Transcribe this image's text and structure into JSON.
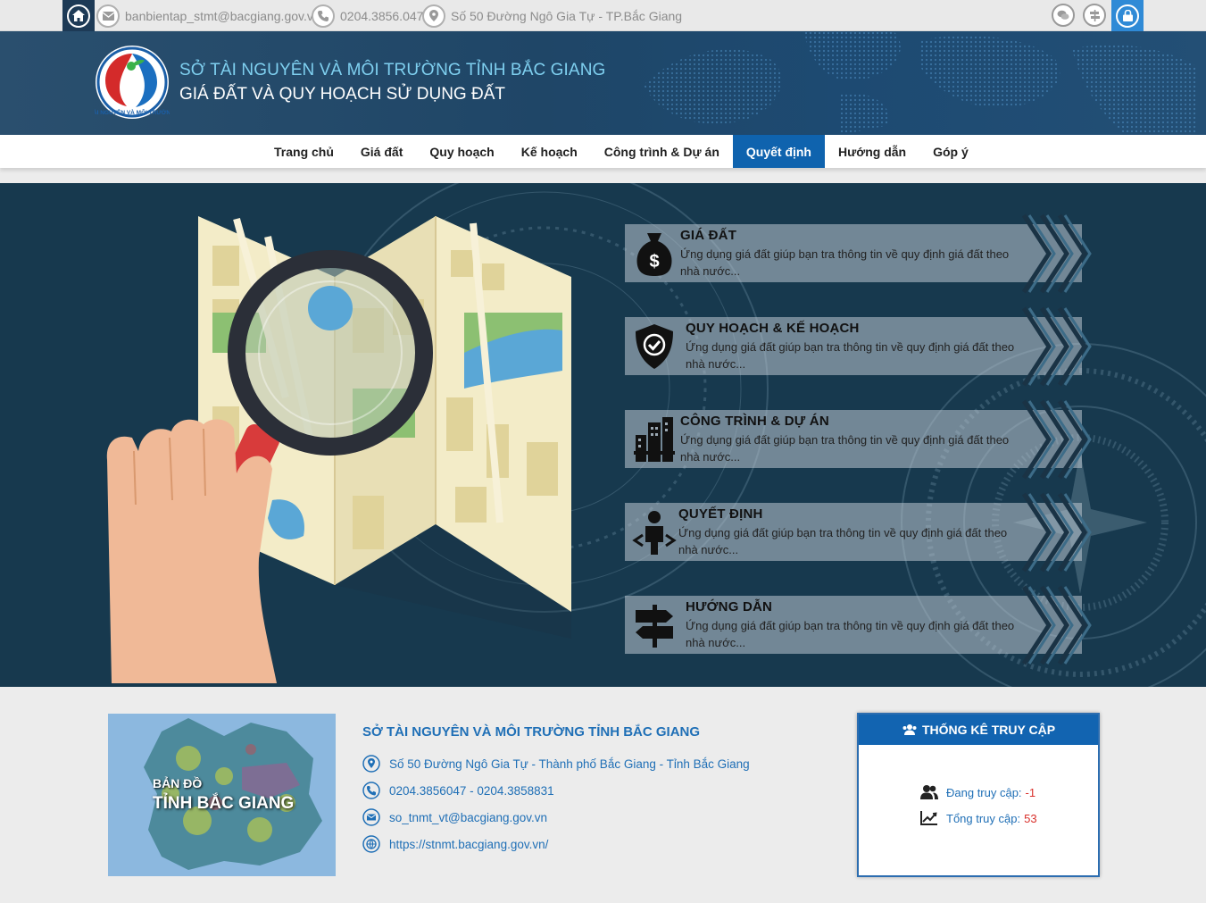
{
  "topbar": {
    "email": "banbientap_stmt@bacgiang.gov.vn",
    "phone": "0204.3856.047",
    "address": "Số 50 Đường Ngô Gia Tự - TP.Bắc Giang",
    "icons": [
      "home-icon",
      "mail-icon",
      "phone-icon",
      "map-pin-icon",
      "chat-icon",
      "signpost-icon",
      "lock-icon"
    ]
  },
  "header": {
    "title1": "SỞ TÀI NGUYÊN VÀ MÔI TRƯỜNG TỈNH BẮC GIANG",
    "title2": "GIÁ ĐẤT VÀ QUY HOẠCH SỬ DỤNG ĐẤT",
    "logo_text": "TÀI NGUYÊN VÀ MÔI TRƯỜNG"
  },
  "nav": {
    "items": [
      "Trang chủ",
      "Giá đất",
      "Quy hoạch",
      "Kế hoạch",
      "Công trình & Dự án",
      "Quyết định",
      "Hướng dẫn",
      "Góp ý"
    ],
    "active": "Quyết định"
  },
  "features": [
    {
      "title": "GIÁ ĐẤT",
      "desc": "Ứng dụng giá đất giúp bạn tra thông tin về quy định giá đất theo nhà nước...",
      "icon": "money-bag-icon"
    },
    {
      "title": "QUY HOẠCH & KẾ HOẠCH",
      "desc": "Ứng dụng giá đất giúp bạn tra thông tin về quy định giá đất theo nhà nước...",
      "icon": "shield-check-icon"
    },
    {
      "title": "CÔNG TRÌNH & DỰ ÁN",
      "desc": "Ứng dụng giá đất giúp bạn tra thông tin về quy định giá đất theo nhà nước...",
      "icon": "buildings-icon"
    },
    {
      "title": "QUYẾT ĐỊNH",
      "desc": "Ứng dụng giá đất giúp bạn tra thông tin về quy định giá đất theo nhà nước...",
      "icon": "decision-person-icon"
    },
    {
      "title": "HƯỚNG DẪN",
      "desc": "Ứng dụng giá đất giúp bạn tra thông tin về quy định giá đất theo nhà nước...",
      "icon": "signpost-icon"
    }
  ],
  "footer": {
    "map_label1": "BẢN ĐỒ",
    "map_label2": "TỈNH BẮC GIANG",
    "org_title": "SỞ TÀI NGUYÊN VÀ MÔI TRƯỜNG TỈNH BẮC GIANG",
    "address": "Số 50 Đường Ngô Gia Tự - Thành phố Bắc Giang - Tỉnh Bắc Giang",
    "phone": "0204.3856047 - 0204.3858831",
    "email": "so_tnmt_vt@bacgiang.gov.vn",
    "website": "https://stnmt.bacgiang.gov.vn/"
  },
  "stats": {
    "title": "THỐNG KÊ TRUY CẬP",
    "online_label": "Đang truy cập:",
    "online_value": "-1",
    "total_label": "Tổng truy cập:",
    "total_value": "53"
  },
  "colors": {
    "nav_active": "#0f63ae",
    "header_bg": "#1f4667",
    "hero_bg": "#16384d",
    "link": "#1f6fb6",
    "stat_value": "#d9302b"
  }
}
